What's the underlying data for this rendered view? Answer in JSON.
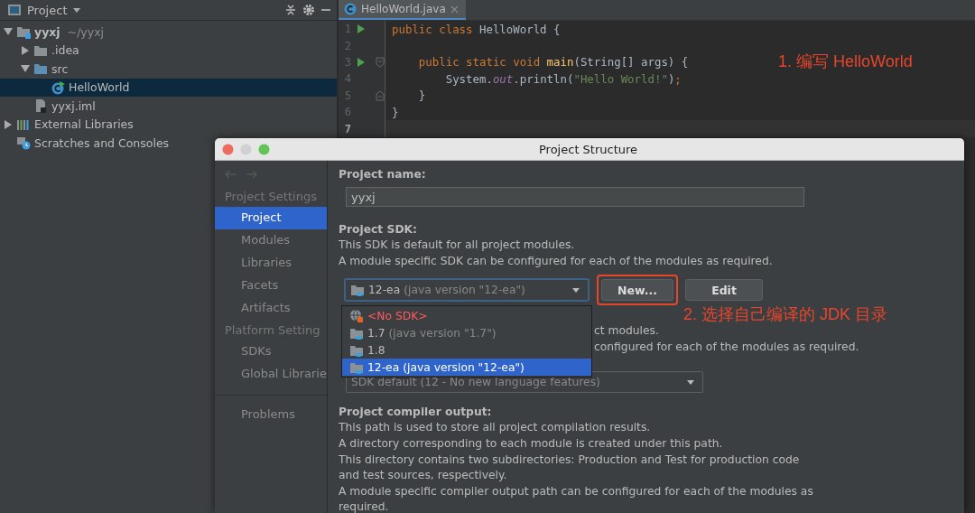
{
  "project_panel": {
    "title": "Project",
    "tree": [
      {
        "kind": "module",
        "name": "yyxj",
        "path": "~/yyxj",
        "expanded": true,
        "selected": false,
        "children": [
          {
            "kind": "folder",
            "name": ".idea",
            "expanded": false,
            "selected": false
          },
          {
            "kind": "source-folder",
            "name": "src",
            "expanded": true,
            "selected": false,
            "children": [
              {
                "kind": "class",
                "name": "HelloWorld",
                "selected": true
              }
            ]
          },
          {
            "kind": "iml",
            "name": "yyxj.iml",
            "selected": false
          }
        ]
      },
      {
        "kind": "libraries",
        "name": "External Libraries",
        "expanded": false,
        "selected": false
      },
      {
        "kind": "scratches",
        "name": "Scratches and Consoles",
        "selected": false
      }
    ]
  },
  "editor": {
    "tabs": [
      {
        "label": "HelloWorld.java",
        "selected": true
      }
    ],
    "lines": [
      {
        "number": "1",
        "run_marker": true,
        "current": false,
        "tokens": [
          {
            "kind": "keyword",
            "text": "public class "
          },
          {
            "kind": "plain",
            "text": "HelloWorld {"
          }
        ]
      },
      {
        "number": "2",
        "run_marker": false,
        "current": false
      },
      {
        "number": "3",
        "run_marker": true,
        "fold_start": true,
        "current": false,
        "tokens": [
          {
            "kind": "keyword",
            "text": "    public static void "
          },
          {
            "kind": "method",
            "text": "main"
          },
          {
            "kind": "plain",
            "text": "(String[] args) {"
          }
        ]
      },
      {
        "number": "4",
        "run_marker": false,
        "current": false,
        "tokens": [
          {
            "kind": "plain",
            "text": "        System."
          },
          {
            "kind": "field",
            "text": "out"
          },
          {
            "kind": "plain",
            "text": ".println("
          },
          {
            "kind": "string",
            "text": "\"Hello World!\""
          },
          {
            "kind": "plain",
            "text": ")"
          },
          {
            "kind": "keyword",
            "text": ";"
          }
        ]
      },
      {
        "number": "5",
        "run_marker": false,
        "fold_end": true,
        "current": false,
        "tokens": [
          {
            "kind": "plain",
            "text": "    }"
          }
        ]
      },
      {
        "number": "6",
        "run_marker": false,
        "current": false,
        "tokens": [
          {
            "kind": "plain",
            "text": "}"
          }
        ]
      },
      {
        "number": "7",
        "run_marker": false,
        "current": true
      }
    ],
    "annotation": "1. 编写 HelloWorld"
  },
  "dialog": {
    "title": "Project Structure",
    "sidebar": [
      {
        "heading": "Project Settings",
        "items": [
          {
            "label": "Project",
            "selected": true
          },
          {
            "label": "Modules",
            "selected": false
          },
          {
            "label": "Libraries",
            "selected": false
          },
          {
            "label": "Facets",
            "selected": false
          },
          {
            "label": "Artifacts",
            "selected": false
          }
        ]
      },
      {
        "heading": "Platform Setting",
        "items": [
          {
            "label": "SDKs",
            "selected": false
          },
          {
            "label": "Global Librarie",
            "selected": false
          }
        ]
      },
      {
        "items": [
          {
            "label": "Problems",
            "selected": false
          }
        ]
      }
    ],
    "project_name": {
      "label": "Project name:",
      "value": "yyxj"
    },
    "project_sdk": {
      "label": "Project SDK:",
      "description": [
        "This SDK is default for all project modules.",
        "A module specific SDK can be configured for each of the modules as required."
      ],
      "combo": {
        "name": "12-ea",
        "detail": "(java version \"12-ea\")"
      },
      "buttons": [
        {
          "label": "New...",
          "highlighted": true
        },
        {
          "label": "Edit",
          "highlighted": false
        }
      ],
      "annotation": "2. 选择自己编译的 JDK 目录",
      "options": [
        {
          "kind": "none",
          "name": "<No SDK>",
          "selected": false
        },
        {
          "kind": "jdk",
          "name": "1.7",
          "detail": "(java version \"1.7\")",
          "selected": false
        },
        {
          "kind": "jdk",
          "name": "1.8",
          "selected": false
        },
        {
          "kind": "jdk",
          "name": "12-ea",
          "detail": "(java version \"12-ea\")",
          "selected": true
        }
      ]
    },
    "language_level": {
      "fragments": [
        "ct modules.",
        "configured for each of the modules as required."
      ],
      "combo": "SDK default (12 - No new language features)"
    },
    "compiler_output": {
      "label": "Project compiler output:",
      "description": [
        "This path is used to store all project compilation results.",
        "A directory corresponding to each module is created under this path.",
        "This directory contains two subdirectories: Production and Test for production code",
        "and test sources, respectively.",
        "A module specific compiler output path can be configured for each of the modules as",
        "required."
      ]
    }
  }
}
